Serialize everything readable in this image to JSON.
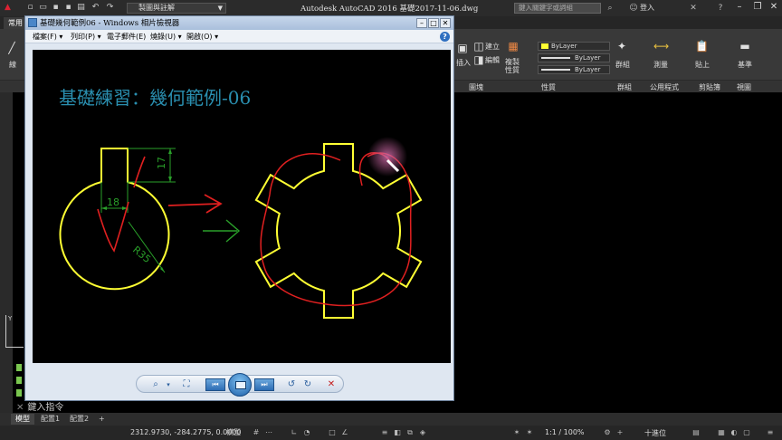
{
  "colors": {
    "acad_bg": "#000000",
    "ribbon_bg": "#393939",
    "viewer_frame": "#dfe7f1",
    "drawing_yellow": "#ffff33",
    "drawing_green": "#2aa02a",
    "drawing_red": "#e02020",
    "title_blue": "#2a8fb0"
  },
  "acad": {
    "workspace": "製圖與註解",
    "title": "Autodesk AutoCAD 2016    基礎2017-11-06.dwg",
    "search_placeholder": "鍵入關鍵字或詞組",
    "login": "登入",
    "tab_home": "常用",
    "ribbon": {
      "line": "線",
      "insert": "插入",
      "edit": "編輯",
      "create": "建立",
      "match": "複製性質",
      "bylayer": "ByLayer",
      "bylayer_color": "ByLayer",
      "bylayer_line": "ByLayer",
      "group": "群組",
      "measure": "測量",
      "paste": "貼上",
      "base": "基準"
    },
    "panels": {
      "block": "圖塊",
      "properties": "性質",
      "groups": "群組",
      "utilities": "公用程式",
      "clipboard": "剪貼簿",
      "view": "視圖"
    },
    "command_hint": "鍵入指令",
    "layout_tabs": [
      "模型",
      "配置1",
      "配置2"
    ],
    "coords": "2312.9730, -284.2775, 0.0000",
    "model_label": "模型",
    "zoom": "1:1 / 100%",
    "units": "十進位"
  },
  "viewer": {
    "title": "基礎幾何範例06 - Windows 相片檢視器",
    "menu": [
      "檔案(F)",
      "列印(P)",
      "電子郵件(E)",
      "燒錄(U)",
      "開啟(O)"
    ],
    "help": "?",
    "photo_title": "基礎練習：幾何範例-06",
    "dims": {
      "slot_height": "17",
      "slot_width": "18",
      "radius": "R35"
    }
  }
}
